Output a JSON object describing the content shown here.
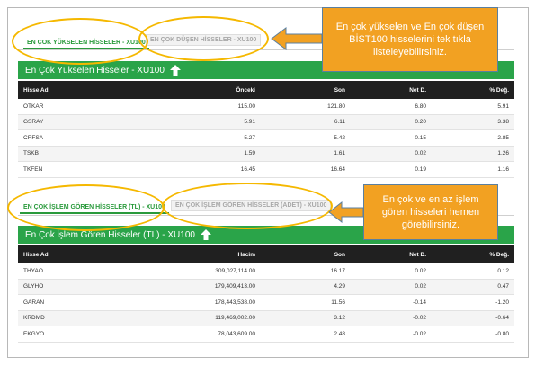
{
  "top_section": {
    "tab_active": "EN ÇOK YÜKSELEN HİSSELER - XU100",
    "tab_inactive": "EN ÇOK DÜŞEN HİSSELER - XU100",
    "header": "En Çok Yükselen Hisseler - XU100",
    "columns": [
      "Hisse Adı",
      "Önceki",
      "Son",
      "Net D.",
      "% Değ."
    ],
    "rows": [
      [
        "OTKAR",
        "115.00",
        "121.80",
        "6.80",
        "5.91"
      ],
      [
        "GSRAY",
        "5.91",
        "6.11",
        "0.20",
        "3.38"
      ],
      [
        "CRFSA",
        "5.27",
        "5.42",
        "0.15",
        "2.85"
      ],
      [
        "TSKB",
        "1.59",
        "1.61",
        "0.02",
        "1.26"
      ],
      [
        "TKFEN",
        "16.45",
        "16.64",
        "0.19",
        "1.16"
      ]
    ]
  },
  "bottom_section": {
    "tab_active": "EN ÇOK İŞLEM GÖREN HİSSELER (TL) - XU100",
    "tab_inactive": "EN ÇOK İŞLEM GÖREN HİSSELER (ADET) - XU100",
    "header": "En Çok işlem Gören Hisseler (TL) - XU100",
    "columns": [
      "Hisse Adı",
      "Hacim",
      "Son",
      "Net D.",
      "% Değ."
    ],
    "rows": [
      [
        "THYAO",
        "309,027,114.00",
        "16.17",
        "0.02",
        "0.12"
      ],
      [
        "GLYHO",
        "179,409,413.00",
        "4.29",
        "0.02",
        "0.47"
      ],
      [
        "GARAN",
        "178,443,538.00",
        "11.56",
        "-0.14",
        "-1.20"
      ],
      [
        "KRDMD",
        "119,469,002.00",
        "3.12",
        "-0.02",
        "-0.64"
      ],
      [
        "EKGYO",
        "78,043,609.00",
        "2.48",
        "-0.02",
        "-0.80"
      ]
    ]
  },
  "callouts": {
    "top": "En çok yükselen ve En çok düşen BİST100 hisselerini tek tıkla listeleyebilirsiniz.",
    "bottom": "En çok ve en az işlem gören hisseleri  hemen görebilirsiniz."
  },
  "colors": {
    "accent_green": "#2aa449",
    "highlight_orange": "#f5b800",
    "callout_bg": "#f2a122",
    "table_header": "#202020"
  },
  "icons": {
    "header_arrow": "up-arrow-icon"
  }
}
